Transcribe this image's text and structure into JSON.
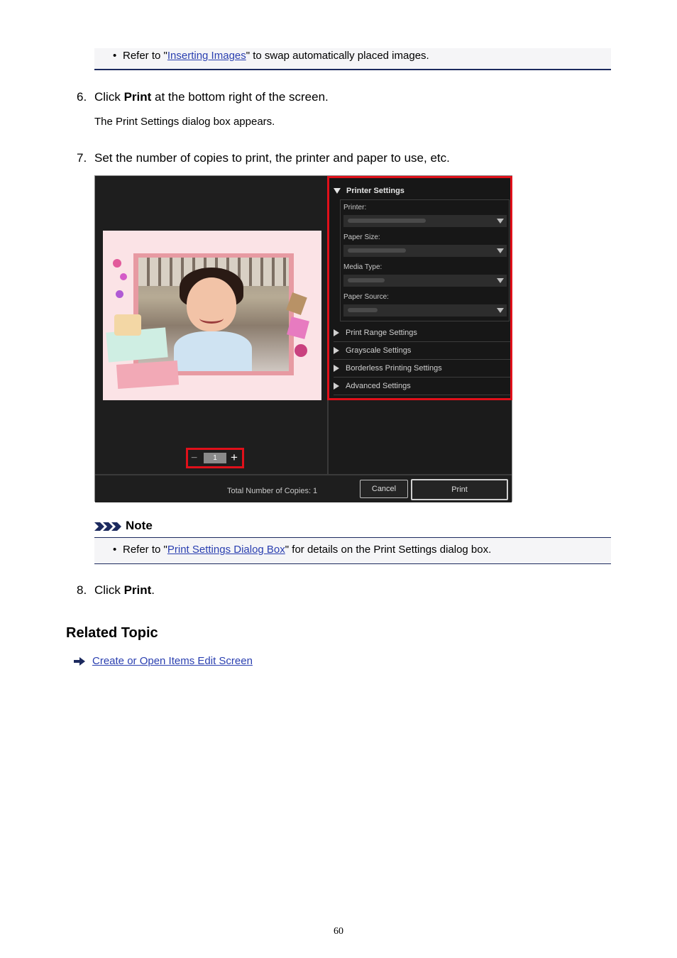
{
  "top_note": {
    "prefix": "Refer to \"",
    "link": "Inserting Images",
    "suffix": "\" to swap automatically placed images."
  },
  "step6": {
    "num": "6.",
    "pre": "Click ",
    "bold": "Print",
    "post": " at the bottom right of the screen.",
    "sub": "The Print Settings dialog box appears."
  },
  "step7": {
    "num": "7.",
    "text": "Set the number of copies to print, the printer and paper to use, etc."
  },
  "dialog": {
    "printer_settings": "Printer Settings",
    "printer_label": "Printer:",
    "paper_size_label": "Paper Size:",
    "media_type_label": "Media Type:",
    "paper_source_label": "Paper Source:",
    "print_range": "Print Range Settings",
    "grayscale": "Grayscale Settings",
    "borderless": "Borderless Printing Settings",
    "advanced": "Advanced Settings",
    "copies_value": "1",
    "minus": "−",
    "plus": "+",
    "total_label": "Total Number of Copies:  1",
    "cancel": "Cancel",
    "print": "Print"
  },
  "note": {
    "heading": "Note",
    "prefix": "Refer to \"",
    "link": "Print Settings Dialog Box",
    "suffix": "\" for details on the Print Settings dialog box."
  },
  "step8": {
    "num": "8.",
    "pre": "Click ",
    "bold": "Print",
    "post": "."
  },
  "related": {
    "heading": "Related Topic",
    "link": "Create or Open Items Edit Screen"
  },
  "page_number": "60"
}
